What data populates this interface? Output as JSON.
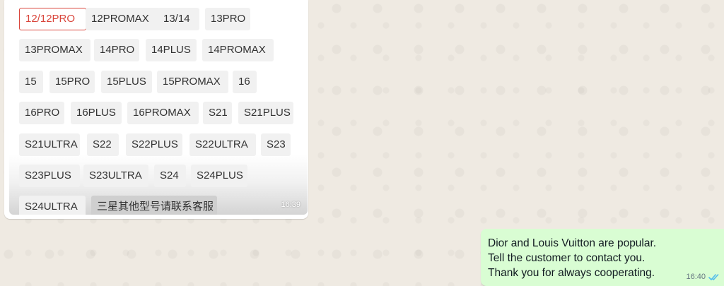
{
  "incoming_message": {
    "models": [
      "12/12PRO",
      "12PROMAX",
      "13/14",
      "13PRO",
      "13PROMAX",
      "14PRO",
      "14PLUS",
      "14PROMAX",
      "15",
      "15PRO",
      "15PLUS",
      "15PROMAX",
      "16",
      "16PRO",
      "16PLUS",
      "16PROMAX",
      "S21",
      "S21PLUS",
      "S21ULTRA",
      "S22",
      "S22PLUS",
      "S22ULTRA",
      "S23",
      "S23PLUS",
      "S23ULTRA",
      "S24",
      "S24PLUS",
      "S24ULTRA",
      "三星其他型号请联系客服"
    ],
    "selected_model": "12/12PRO",
    "time": "16:39"
  },
  "outgoing_message": {
    "lines": [
      "Dior and Louis Vuitton are popular.",
      "Tell the customer to contact you.",
      "Thank you for always cooperating."
    ],
    "time": "16:40",
    "status_icon": "double-check-read-icon"
  },
  "colors": {
    "wallpaper": "#efeae2",
    "outgoing_bubble": "#d9fdd3",
    "selected_chip": "#d9453b",
    "read_ticks": "#53bdeb"
  }
}
